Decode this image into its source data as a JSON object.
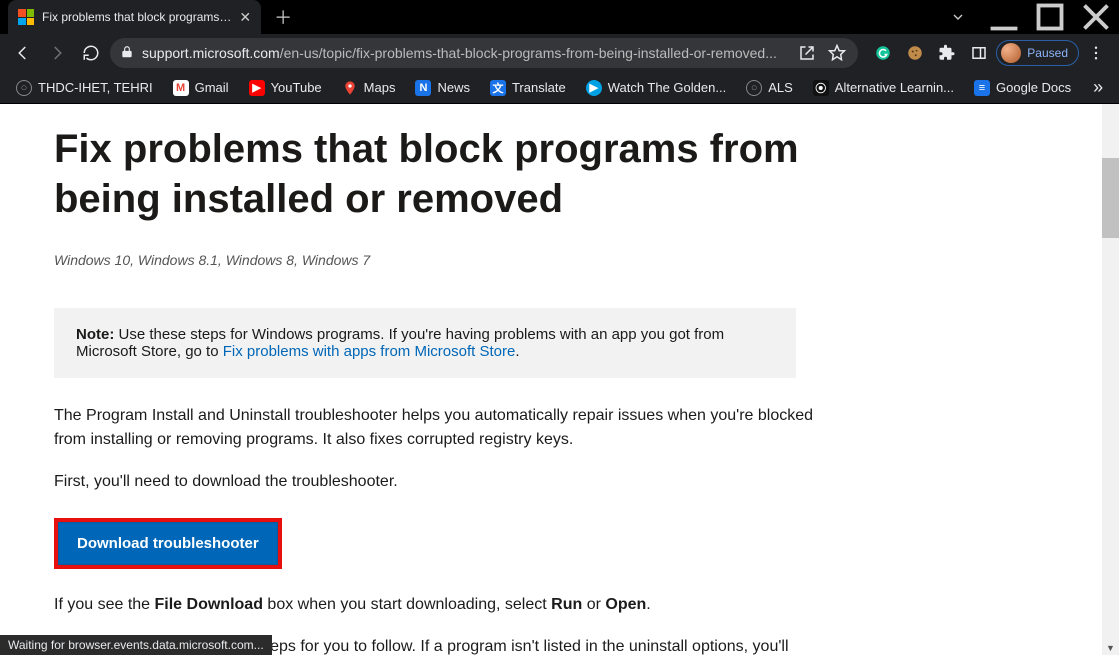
{
  "tab": {
    "title": "Fix problems that block programs…"
  },
  "toolbar": {
    "url_domain": "support.microsoft.com",
    "url_path": "/en-us/topic/fix-problems-that-block-programs-from-being-installed-or-removed...",
    "paused_label": "Paused"
  },
  "bookmarks": [
    {
      "label": "THDC-IHET, TEHRI",
      "icon_bg": "#6b6b6b",
      "glyph": "○"
    },
    {
      "label": "Gmail",
      "icon_bg": "#ffffff",
      "glyph": "M",
      "glyph_color": "#ea4335"
    },
    {
      "label": "YouTube",
      "icon_bg": "#ff0000",
      "glyph": "▶"
    },
    {
      "label": "Maps",
      "icon_bg": "#1a73e8",
      "glyph": "◆"
    },
    {
      "label": "News",
      "icon_bg": "#1a73e8",
      "glyph": "N"
    },
    {
      "label": "Translate",
      "icon_bg": "#1a73e8",
      "glyph": "文"
    },
    {
      "label": "Watch The Golden...",
      "icon_bg": "#00a1e4",
      "glyph": "▶"
    },
    {
      "label": "ALS",
      "icon_bg": "#6b6b6b",
      "glyph": "○"
    },
    {
      "label": "Alternative Learnin...",
      "icon_bg": "#111",
      "glyph": "⦿"
    },
    {
      "label": "Google Docs",
      "icon_bg": "#1a73e8",
      "glyph": "≡"
    }
  ],
  "content": {
    "heading": "Fix problems that block programs from being installed or removed",
    "subtitle": "Windows 10, Windows 8.1, Windows 8, Windows 7",
    "note_label": "Note:",
    "note_text_before": " Use these steps for Windows programs. If you're having problems with an app you got from Microsoft Store, go to ",
    "note_link": "Fix problems with apps from Microsoft Store",
    "note_text_after": ".",
    "para1": "The Program Install and Uninstall troubleshooter helps you automatically repair issues when you're blocked from installing or removing programs. It also fixes corrupted registry keys.",
    "para2": "First, you'll need to download the troubleshooter.",
    "download_label": "Download troubleshooter",
    "para3_a": "If you see the ",
    "para3_b": "File Download",
    "para3_c": " box when you start downloading, select ",
    "para3_d": "Run",
    "para3_e": " or ",
    "para3_f": "Open",
    "para3_g": ".",
    "para4": "The troubleshooter provides steps for you to follow. If a program isn't listed in the uninstall options, you'll"
  },
  "status": "Waiting for browser.events.data.microsoft.com..."
}
